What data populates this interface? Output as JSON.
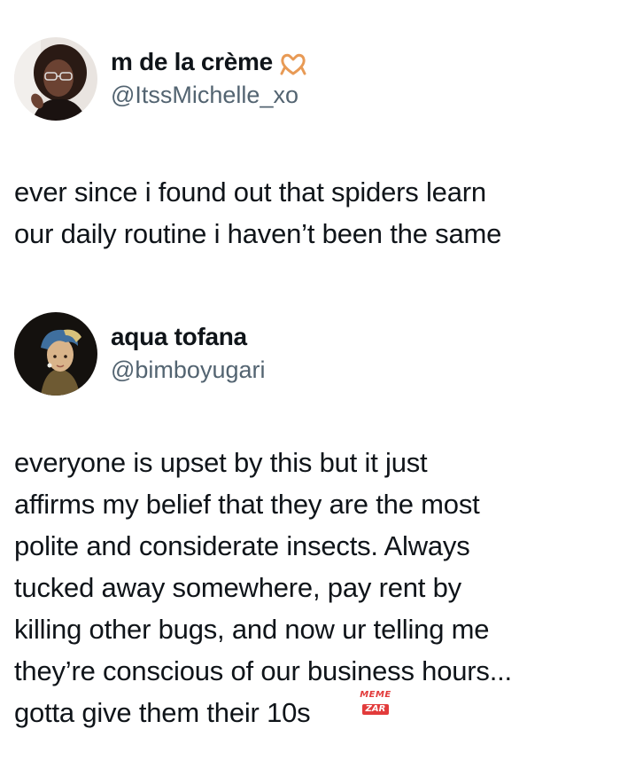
{
  "tweets": [
    {
      "display_name": "m de la crème",
      "handle": "@ItssMichelle_xo",
      "badge_icon": "heart-hands-icon",
      "text": "ever since i found out that spiders learn\nour daily routine i haven’t been the same"
    },
    {
      "display_name": "aqua tofana",
      "handle": "@bimboyugari",
      "text": "everyone is upset by this but it just\naffirms my belief that they are the most\npolite and considerate insects. Always\ntucked away somewhere, pay rent by\nkilling other bugs, and now ur telling me\nthey’re conscious of our business hours...\ngotta give them their 10s"
    }
  ],
  "watermark": {
    "top": "MEME",
    "bottom": "ZAR"
  },
  "colors": {
    "text": "#0f1419",
    "handle": "#536471",
    "emoji": "#e89a55",
    "watermark": "#e23b3b"
  }
}
